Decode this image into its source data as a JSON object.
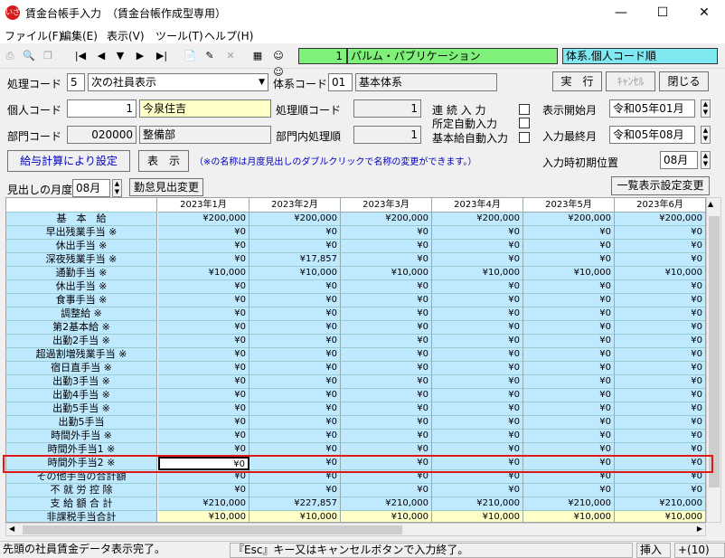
{
  "window": {
    "title": "賃金台帳手入力　（賃金台帳作成型専用）",
    "app_icon_label": "いざ"
  },
  "menu": [
    "ファイル(F)",
    "編集(E)",
    "表示(V)",
    "ツール(T)",
    "ヘルプ(H)"
  ],
  "toolbar": {
    "record_no": "1",
    "company_name": "パルム・パブリケーション",
    "sort_order": "体系.個人コード順"
  },
  "form": {
    "proc_code_label": "処理コード",
    "proc_code": "5",
    "proc_select": "次の社員表示",
    "system_code_label": "体系コード",
    "system_code": "01",
    "system_name": "基本体系",
    "execute": "実　行",
    "cancel": "ｷｬﾝｾﾙ",
    "close": "閉じる",
    "person_code_label": "個人コード",
    "person_code": "1",
    "person_name": "今泉住吉",
    "order_code_label": "処理順コード",
    "order_code": "1",
    "continuous_input": "連 続 入 力",
    "auto_fixed_input": "所定自動入力",
    "auto_base_input": "基本給自動入力",
    "start_month_label": "表示開始月",
    "start_era": "令和05",
    "start_year_unit": "年",
    "start_month": "01",
    "start_month_unit": "月",
    "dept_code_label": "部門コード",
    "dept_code": "020000",
    "dept_name": "整備部",
    "dept_order_label": "部門内処理順",
    "dept_order": "1",
    "last_month_label": "入力最終月",
    "last_era": "令和05",
    "last_year_unit": "年",
    "last_month": "08",
    "last_month_unit": "月",
    "calc_button": "給与計算により設定",
    "display_button": "表　示",
    "note": "（※の名称は月度見出しのダブルクリックで名称の変更ができます。）",
    "initial_pos_label": "入力時初期位置",
    "initial_pos": "08",
    "initial_pos_unit": "月",
    "heading_month_label": "見出しの月度",
    "heading_month": "08",
    "heading_month_unit": "月",
    "attendance_heading_button": "勤怠見出変更",
    "list_settings_button": "一覧表示設定変更"
  },
  "grid": {
    "columns": [
      "2023年1月",
      "2023年2月",
      "2023年3月",
      "2023年4月",
      "2023年5月",
      "2023年6月"
    ],
    "rows": [
      {
        "label": "基　本　給",
        "values": [
          "¥200,000",
          "¥200,000",
          "¥200,000",
          "¥200,000",
          "¥200,000",
          "¥200,000"
        ]
      },
      {
        "label": "早出残業手当 ※",
        "values": [
          "¥0",
          "¥0",
          "¥0",
          "¥0",
          "¥0",
          "¥0"
        ]
      },
      {
        "label": "休出手当 ※",
        "values": [
          "¥0",
          "¥0",
          "¥0",
          "¥0",
          "¥0",
          "¥0"
        ]
      },
      {
        "label": "深夜残業手当 ※",
        "values": [
          "¥0",
          "¥17,857",
          "¥0",
          "¥0",
          "¥0",
          "¥0"
        ]
      },
      {
        "label": "通勤手当 ※",
        "values": [
          "¥10,000",
          "¥10,000",
          "¥10,000",
          "¥10,000",
          "¥10,000",
          "¥10,000"
        ]
      },
      {
        "label": "休出手当 ※",
        "values": [
          "¥0",
          "¥0",
          "¥0",
          "¥0",
          "¥0",
          "¥0"
        ]
      },
      {
        "label": "食事手当 ※",
        "values": [
          "¥0",
          "¥0",
          "¥0",
          "¥0",
          "¥0",
          "¥0"
        ]
      },
      {
        "label": "調整給 ※",
        "values": [
          "¥0",
          "¥0",
          "¥0",
          "¥0",
          "¥0",
          "¥0"
        ]
      },
      {
        "label": "第2基本給 ※",
        "values": [
          "¥0",
          "¥0",
          "¥0",
          "¥0",
          "¥0",
          "¥0"
        ]
      },
      {
        "label": "出勤2手当 ※",
        "values": [
          "¥0",
          "¥0",
          "¥0",
          "¥0",
          "¥0",
          "¥0"
        ]
      },
      {
        "label": "超過割増残業手当 ※",
        "values": [
          "¥0",
          "¥0",
          "¥0",
          "¥0",
          "¥0",
          "¥0"
        ]
      },
      {
        "label": "宿日直手当 ※",
        "values": [
          "¥0",
          "¥0",
          "¥0",
          "¥0",
          "¥0",
          "¥0"
        ]
      },
      {
        "label": "出勤3手当 ※",
        "values": [
          "¥0",
          "¥0",
          "¥0",
          "¥0",
          "¥0",
          "¥0"
        ]
      },
      {
        "label": "出勤4手当 ※",
        "values": [
          "¥0",
          "¥0",
          "¥0",
          "¥0",
          "¥0",
          "¥0"
        ]
      },
      {
        "label": "出勤5手当 ※",
        "values": [
          "¥0",
          "¥0",
          "¥0",
          "¥0",
          "¥0",
          "¥0"
        ]
      },
      {
        "label": "出勤5手当",
        "values": [
          "¥0",
          "¥0",
          "¥0",
          "¥0",
          "¥0",
          "¥0"
        ]
      },
      {
        "label": "時間外手当 ※",
        "values": [
          "¥0",
          "¥0",
          "¥0",
          "¥0",
          "¥0",
          "¥0"
        ]
      },
      {
        "label": "時間外手当1 ※",
        "values": [
          "¥0",
          "¥0",
          "¥0",
          "¥0",
          "¥0",
          "¥0"
        ]
      },
      {
        "label": "時間外手当2 ※",
        "values": [
          "¥0",
          "¥0",
          "¥0",
          "¥0",
          "¥0",
          "¥0"
        ]
      },
      {
        "label": "その他手当の合計額",
        "values": [
          "¥0",
          "¥0",
          "¥0",
          "¥0",
          "¥0",
          "¥0"
        ]
      },
      {
        "label": "不 就 労 控 除",
        "values": [
          "¥0",
          "¥0",
          "¥0",
          "¥0",
          "¥0",
          "¥0"
        ]
      },
      {
        "label": "支 給 額 合 計",
        "values": [
          "¥210,000",
          "¥227,857",
          "¥210,000",
          "¥210,000",
          "¥210,000",
          "¥210,000"
        ]
      },
      {
        "label": "非課税手当合計",
        "values": [
          "¥10,000",
          "¥10,000",
          "¥10,000",
          "¥10,000",
          "¥10,000",
          "¥10,000"
        ]
      }
    ]
  },
  "status": {
    "left": "先頭の社員賃金データ表示完了。",
    "middle": "『Esc』キー又はキャンセルボタンで入力終了。",
    "mode": "挿入",
    "count": "+(10)"
  },
  "colors": {
    "grid_cell": "#bfe9ff",
    "highlight": "#e01818",
    "green_box": "#7ff07a",
    "yellow_field": "#ffffc8"
  }
}
